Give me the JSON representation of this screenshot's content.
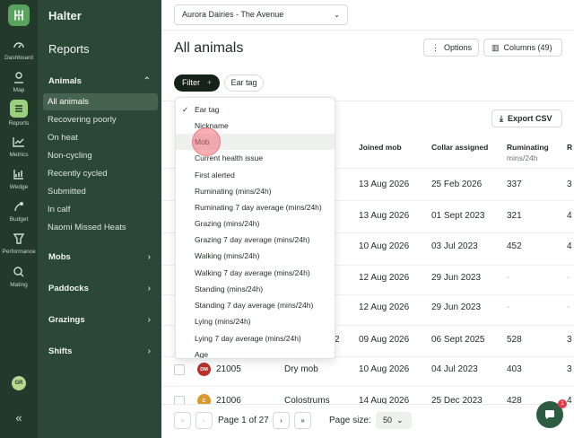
{
  "rail": {
    "items": [
      {
        "label": "Dashboard",
        "icon": "gauge-icon"
      },
      {
        "label": "Map",
        "icon": "map-pin-icon"
      },
      {
        "label": "Reports",
        "icon": "list-icon"
      },
      {
        "label": "Metrics",
        "icon": "chart-icon"
      },
      {
        "label": "Wedge",
        "icon": "wedge-icon"
      },
      {
        "label": "Budget",
        "icon": "budget-icon"
      },
      {
        "label": "Performance",
        "icon": "performance-icon"
      },
      {
        "label": "Mating",
        "icon": "mating-icon"
      }
    ],
    "avatar": "GR",
    "collapse": "«"
  },
  "sidebar": {
    "brand": "Halter",
    "title": "Reports",
    "animals_label": "Animals",
    "animals_items": [
      {
        "label": "All animals"
      },
      {
        "label": "Recovering poorly"
      },
      {
        "label": "On heat"
      },
      {
        "label": "Non-cycling"
      },
      {
        "label": "Recently cycled"
      },
      {
        "label": "Submitted"
      },
      {
        "label": "In calf"
      },
      {
        "label": "Naomi Missed Heats"
      }
    ],
    "groups": [
      {
        "label": "Mobs"
      },
      {
        "label": "Paddocks"
      },
      {
        "label": "Grazings"
      },
      {
        "label": "Shifts"
      }
    ]
  },
  "topbar": {
    "farm": "Aurora Dairies - The Avenue"
  },
  "page": {
    "title": "All animals",
    "options_label": "Options",
    "columns_label": "Columns (49)",
    "filter_label": "Filter",
    "ear_tag_chip": "Ear tag",
    "export_label": "Export CSV"
  },
  "table": {
    "headers": [
      {
        "label": "Joined mob",
        "unit": ""
      },
      {
        "label": "Collar assigned",
        "unit": ""
      },
      {
        "label": "Ruminating",
        "unit": "mins/24h"
      },
      {
        "label": "R",
        "unit": ""
      }
    ],
    "rows": [
      {
        "ear_tag": "",
        "mob": "",
        "joined": "13 Aug 2026",
        "collar": "25 Feb 2026",
        "rum": "337",
        "extra": "3"
      },
      {
        "ear_tag": "",
        "mob": "",
        "joined": "13 Aug 2026",
        "collar": "01 Sept 2023",
        "rum": "321",
        "extra": "4"
      },
      {
        "ear_tag": "",
        "mob": "",
        "joined": "10 Aug 2026",
        "collar": "03 Jul 2023",
        "rum": "452",
        "extra": "4"
      },
      {
        "ear_tag": "",
        "mob": "",
        "joined": "12 Aug 2026",
        "collar": "29 Jun 2023",
        "rum": "-",
        "extra": "-"
      },
      {
        "ear_tag": "",
        "mob": "",
        "joined": "12 Aug 2026",
        "collar": "29 Jun 2023",
        "rum": "-",
        "extra": "-"
      },
      {
        "ear_tag": "",
        "mob": "2",
        "joined": "09 Aug 2026",
        "collar": "06 Sept 2025",
        "rum": "528",
        "extra": "3"
      },
      {
        "ear_tag": "21005",
        "mob": "Dry mob",
        "badge": "DM",
        "badge_color": "#b8312f",
        "joined": "10 Aug 2026",
        "collar": "04 Jul 2023",
        "rum": "403",
        "extra": "3"
      },
      {
        "ear_tag": "21006",
        "mob": "Colostrums",
        "badge": "C",
        "badge_color": "#d99a2b",
        "joined": "14 Aug 2026",
        "collar": "25 Dec 2023",
        "rum": "428",
        "extra": "4"
      }
    ]
  },
  "dropdown": {
    "items": [
      {
        "label": "Ear tag",
        "checked": true
      },
      {
        "label": "Nickname"
      },
      {
        "label": "Mob"
      },
      {
        "label": "Current health issue"
      },
      {
        "label": "First alerted"
      },
      {
        "label": "Ruminating (mins/24h)"
      },
      {
        "label": "Ruminating 7 day average (mins/24h)"
      },
      {
        "label": "Grazing (mins/24h)"
      },
      {
        "label": "Grazing 7 day average (mins/24h)"
      },
      {
        "label": "Walking (mins/24h)"
      },
      {
        "label": "Walking 7 day average (mins/24h)"
      },
      {
        "label": "Standing (mins/24h)"
      },
      {
        "label": "Standing 7 day average (mins/24h)"
      },
      {
        "label": "Lying (mins/24h)"
      },
      {
        "label": "Lying 7 day average (mins/24h)"
      },
      {
        "label": "Age"
      }
    ]
  },
  "pagination": {
    "first": "«",
    "prev": "‹",
    "page_text": "Page 1 of 27",
    "next": "›",
    "last": "»",
    "size_label": "Page size:",
    "size_value": "50"
  },
  "chat": {
    "badge": "1"
  },
  "colors": {
    "rail": "#23392b",
    "sidebar": "#2b4735",
    "accent": "#9bd07c",
    "dark": "#15211a"
  }
}
